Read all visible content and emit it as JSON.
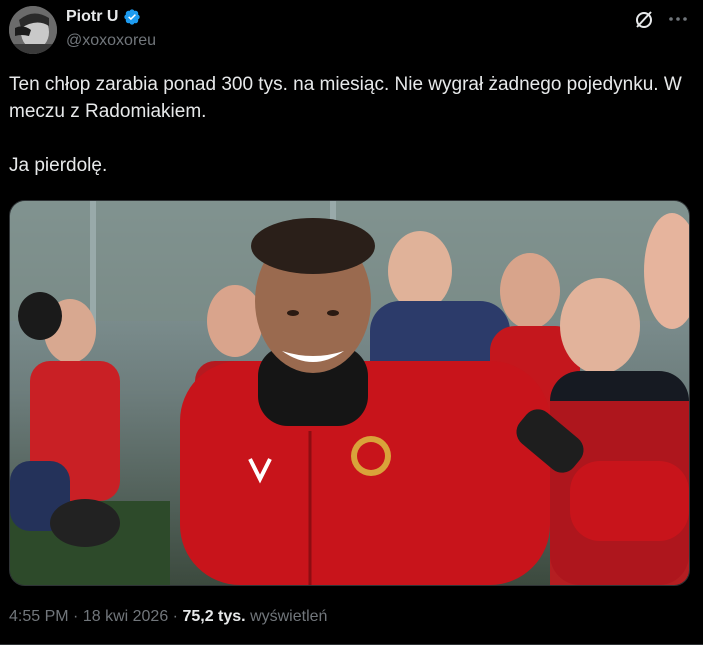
{
  "author": {
    "name": "Piotr U",
    "handle": "@xoxoxoreu",
    "verified": true,
    "verified_color": "#1d9bf0"
  },
  "tweet": {
    "text": "Ten chłop zarabia ponad 300 tys. na miesiąc. Nie wygrał żadnego pojedynku. W meczu z Radomiakiem.\n\nJa pierdolę."
  },
  "meta": {
    "time": "4:55 PM",
    "date": "18 kwi 2026",
    "views_count": "75,2 tys.",
    "views_label": "wyświetleń"
  },
  "icons": {
    "grok": "grok-icon",
    "more": "more-icon",
    "verified": "verified-badge-icon"
  },
  "colors": {
    "background": "#000000",
    "text": "#e7e9ea",
    "secondary_text": "#71767b",
    "jacket_red": "#c8141b"
  }
}
